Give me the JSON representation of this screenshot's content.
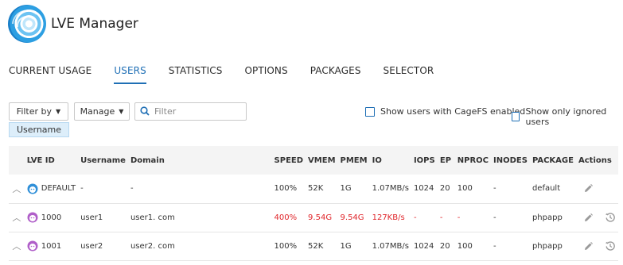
{
  "app": {
    "title": "LVE Manager"
  },
  "tabs": [
    {
      "label": "CURRENT USAGE",
      "active": false
    },
    {
      "label": "USERS",
      "active": true
    },
    {
      "label": "STATISTICS",
      "active": false
    },
    {
      "label": "OPTIONS",
      "active": false
    },
    {
      "label": "PACKAGES",
      "active": false
    },
    {
      "label": "SELECTOR",
      "active": false
    }
  ],
  "toolbar": {
    "filter_by_label": "Filter by",
    "manage_label": "Manage",
    "search_placeholder": "Filter",
    "cagefs_checkbox_label": "Show users with CageFS enabled",
    "ignored_checkbox_label": "Show only ignored users",
    "cagefs_checked": false,
    "ignored_checked": false
  },
  "filter_chip": {
    "label": "Username"
  },
  "table": {
    "columns": [
      "LVE ID",
      "Username",
      "Domain",
      "SPEED",
      "VMEM",
      "PMEM",
      "IO",
      "IOPS",
      "EP",
      "NPROC",
      "INODES",
      "PACKAGE",
      "Actions"
    ],
    "rows": [
      {
        "lve_id": "DEFAULT",
        "username": "-",
        "domain": "-",
        "speed": "100%",
        "vmem": "52K",
        "pmem": "1G",
        "io": "1.07MB/s",
        "iops": "1024",
        "ep": "20",
        "nproc": "100",
        "inodes": "-",
        "package": "default",
        "over_limit": false,
        "avatar": "default-avatar-icon",
        "actions": [
          "edit-icon"
        ]
      },
      {
        "lve_id": "1000",
        "username": "user1",
        "domain": "user1. com",
        "speed": "400%",
        "vmem": "9.54G",
        "pmem": "9.54G",
        "io": "127KB/s",
        "iops": "-",
        "ep": "-",
        "nproc": "-",
        "inodes": "-",
        "package": "phpapp",
        "over_limit": true,
        "avatar": "user-avatar-icon",
        "actions": [
          "edit-icon",
          "history-icon"
        ]
      },
      {
        "lve_id": "1001",
        "username": "user2",
        "domain": "user2. com",
        "speed": "100%",
        "vmem": "52K",
        "pmem": "1G",
        "io": "1.07MB/s",
        "iops": "1024",
        "ep": "20",
        "nproc": "100",
        "inodes": "-",
        "package": "phpapp",
        "over_limit": false,
        "avatar": "user-avatar-icon",
        "actions": [
          "edit-icon",
          "history-icon"
        ]
      }
    ]
  },
  "colors": {
    "accent": "#1f6fb5",
    "over_limit": "#e0262b",
    "header_bg": "#f4f4f4",
    "chip_bg": "#ddeefa"
  }
}
